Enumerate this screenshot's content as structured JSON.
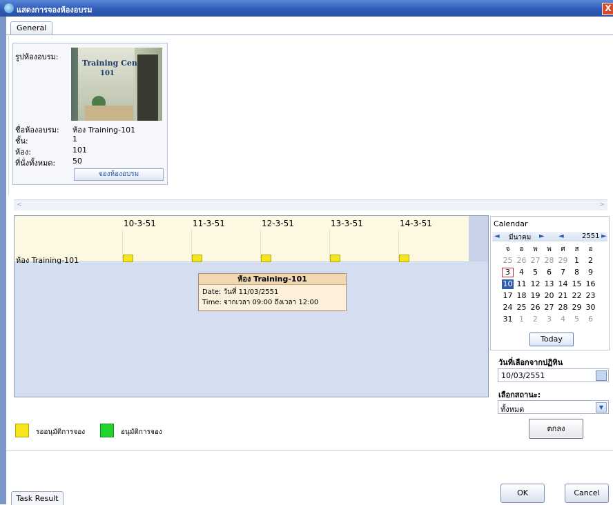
{
  "window": {
    "title": "แสดงการจองห้องอบรม",
    "close_label": "X"
  },
  "tabs": {
    "general": "General"
  },
  "room_card": {
    "image_label": "รูปห้องอบรม:",
    "photo_title": "Training Center",
    "photo_number": "101",
    "name_label": "ชื่อห้องอบรม:",
    "name_value": "ห้อง Training-101",
    "floor_label": "ชั้น:",
    "floor_value": "1",
    "room_label": "ห้อง:",
    "room_value": "101",
    "seats_label": "ที่นั่งทั้งหมด:",
    "seats_value": "50",
    "book_button": "จองห้องอบรม"
  },
  "scrollbar": {
    "left": "<",
    "right": ">"
  },
  "schedule": {
    "dates": [
      "10-3-51",
      "11-3-51",
      "12-3-51",
      "13-3-51",
      "14-3-51"
    ],
    "room": "ห้อง Training-101",
    "tooltip": {
      "title": "ห้อง Training-101",
      "date": "Date: วันที่ 11/03/2551",
      "time": "Time: จากเวลา 09:00 ถึงเวลา 12:00"
    }
  },
  "legend": {
    "pending_label": "รออนุมัติการจอง",
    "approved_label": "อนุมัติการจอง",
    "pending_color": "#f3e522",
    "approved_color": "#22d52e"
  },
  "calendar": {
    "title": "Calendar",
    "month": "มีนาคม",
    "year": "2551",
    "prev": "◄",
    "next": "►",
    "weekdays": [
      "จ",
      "อ",
      "พ",
      "พ",
      "ศ",
      "ส",
      "อ"
    ],
    "weeks": [
      [
        "25",
        "26",
        "27",
        "28",
        "29",
        "1",
        "2"
      ],
      [
        "3",
        "4",
        "5",
        "6",
        "7",
        "8",
        "9"
      ],
      [
        "10",
        "11",
        "12",
        "13",
        "14",
        "15",
        "16"
      ],
      [
        "17",
        "18",
        "19",
        "20",
        "21",
        "22",
        "23"
      ],
      [
        "24",
        "25",
        "26",
        "27",
        "28",
        "29",
        "30"
      ],
      [
        "31",
        "1",
        "2",
        "3",
        "4",
        "5",
        "6"
      ]
    ],
    "today_button": "Today"
  },
  "filters": {
    "date_label": "วันที่เลือกจากปฏิทิน",
    "date_value": "10/03/2551",
    "status_label": "เลือกสถานะ:",
    "status_value": "ทั้งหมด",
    "submit_button": "ตกลง"
  },
  "dialog": {
    "ok": "OK",
    "cancel": "Cancel"
  },
  "task_tab": "Task Result"
}
